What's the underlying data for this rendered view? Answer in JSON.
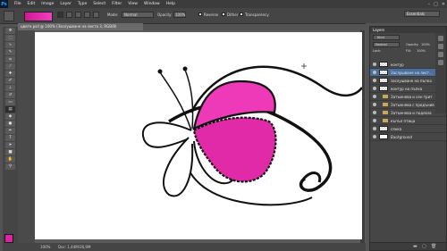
{
  "app": {
    "logo": "Ps"
  },
  "menu": [
    "File",
    "Edit",
    "Image",
    "Layer",
    "Type",
    "Select",
    "Filter",
    "View",
    "Window",
    "Help"
  ],
  "options": {
    "mode_label": "Mode:",
    "mode_value": "Normal",
    "opacity_label": "Opacity:",
    "opacity_value": "100%",
    "reverse_label": "Reverse",
    "dither_label": "Dither",
    "transparency_label": "Transparency",
    "gradient_color": "#e020a8"
  },
  "workspace": "Essentials",
  "document": {
    "tab_title": "цвете.psd @ 100% (Заслушване на листа 3, RGB/8)",
    "status": "Doc: 1,44M/36,9M"
  },
  "layers": {
    "title": "Layers",
    "kind_label": "Kind",
    "blend_value": "Normal",
    "opacity_label": "Opacity:",
    "opacity_value": "100%",
    "lock_label": "Lock:",
    "fill_label": "Fill:",
    "fill_value": "100%",
    "items": [
      {
        "name": "контур",
        "type": "layer"
      },
      {
        "name": "Заслушване на лист...",
        "type": "layer"
      },
      {
        "name": "заслушване на пъпка",
        "type": "layer"
      },
      {
        "name": "контур на пъпка",
        "type": "layer"
      },
      {
        "name": "Затъмнява и сен трит",
        "type": "group"
      },
      {
        "name": "Затъмнява с продъния",
        "type": "group"
      },
      {
        "name": "Затъмнява и подлоза",
        "type": "group"
      },
      {
        "name": "къпъл птица",
        "type": "group"
      },
      {
        "name": "сянка",
        "type": "layer"
      },
      {
        "name": "Background",
        "type": "background"
      }
    ]
  },
  "colors": {
    "foreground": "#e020a8",
    "background": "#ffffff",
    "petal": "#ee3ab8"
  }
}
